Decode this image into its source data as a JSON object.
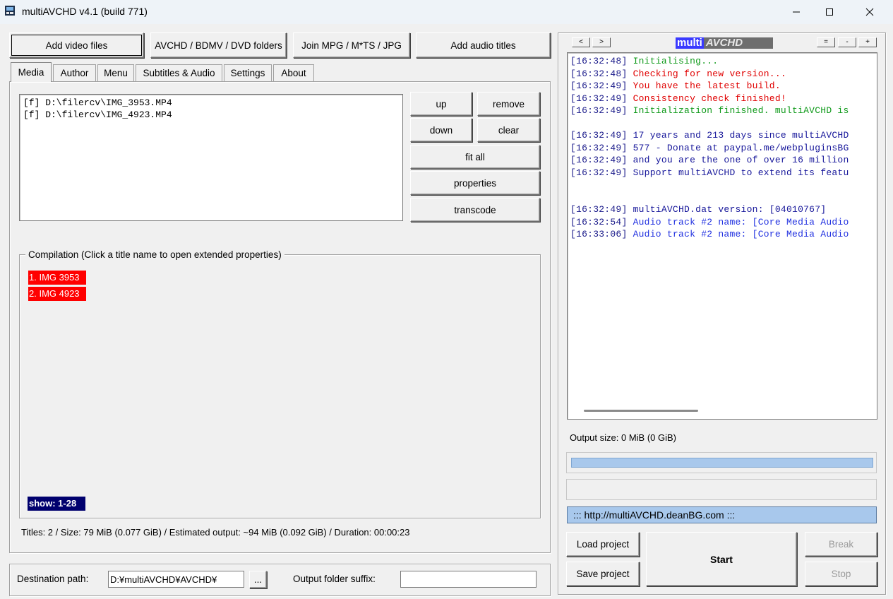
{
  "window": {
    "title": "multiAVCHD v4.1 (build 771)"
  },
  "toolbar": {
    "add_video": "Add video files",
    "avchd_folders": "AVCHD / BDMV / DVD folders",
    "join": "Join MPG / M*TS / JPG",
    "add_audio": "Add audio titles"
  },
  "tabs": [
    "Media",
    "Author",
    "Menu",
    "Subtitles & Audio",
    "Settings",
    "About"
  ],
  "media": {
    "files": [
      "[f] D:\\filercv\\IMG_3953.MP4",
      "[f] D:\\filercv\\IMG_4923.MP4"
    ],
    "buttons": {
      "up": "up",
      "remove": "remove",
      "down": "down",
      "clear": "clear",
      "fit_all": "fit all",
      "properties": "properties",
      "transcode": "transcode"
    }
  },
  "compilation": {
    "legend": "Compilation (Click a title name to open extended properties)",
    "titles": [
      "1. IMG 3953",
      "2. IMG 4923"
    ],
    "show": "show: 1-28"
  },
  "status": "Titles: 2 / Size: 79 MiB (0.077 GiB) / Estimated output: ~94 MiB (0.092 GiB) / Duration: 00:00:23",
  "destination": {
    "label": "Destination path:",
    "value": "D:¥multiAVCHD¥AVCHD¥",
    "browse": "...",
    "suffix_label": "Output folder suffix:",
    "suffix_value": ""
  },
  "log_panel": {
    "nav_prev": "<",
    "nav_next": ">",
    "logo_multi": "multi",
    "logo_avchd": "AVCHD",
    "zoom_buttons": [
      "=",
      "-",
      "+"
    ],
    "lines": [
      {
        "time": "[16:32:48]",
        "text": "Initialising...",
        "color": "green"
      },
      {
        "time": "[16:32:48]",
        "text": "Checking for new version...",
        "color": "red"
      },
      {
        "time": "[16:32:49]",
        "text": "You have the latest build.",
        "color": "red"
      },
      {
        "time": "[16:32:49]",
        "text": "Consistency check finished!",
        "color": "red"
      },
      {
        "time": "[16:32:49]",
        "text": "Initialization finished. multiAVCHD is",
        "color": "green"
      },
      {
        "time": "",
        "text": "",
        "color": "navy"
      },
      {
        "time": "[16:32:49]",
        "text": "17 years and 213 days since multiAVCHD",
        "color": "navy"
      },
      {
        "time": "[16:32:49]",
        "text": "577 - Donate at paypal.me/webpluginsBG",
        "color": "navy"
      },
      {
        "time": "[16:32:49]",
        "text": "and you are the one of over 16 million",
        "color": "navy"
      },
      {
        "time": "[16:32:49]",
        "text": "Support multiAVCHD to extend its featu",
        "color": "navy"
      },
      {
        "time": "",
        "text": "",
        "color": "navy"
      },
      {
        "time": "",
        "text": "",
        "color": "navy"
      },
      {
        "time": "[16:32:49]",
        "text": "multiAVCHD.dat version: [04010767]",
        "color": "navy"
      },
      {
        "time": "[16:32:54]",
        "text": "Audio track #2 name: [Core Media Audio",
        "color": "blue"
      },
      {
        "time": "[16:33:06]",
        "text": "Audio track #2 name: [Core Media Audio",
        "color": "blue"
      }
    ],
    "output_size": "Output size: 0 MiB (0 GiB)",
    "url": "::: http://multiAVCHD.deanBG.com :::",
    "progress": 1.0
  },
  "actions": {
    "load": "Load project",
    "save": "Save project",
    "start": "Start",
    "break": "Break",
    "stop": "Stop"
  },
  "colors": {
    "log_green": "#0f9a1a",
    "log_red": "#e00000",
    "log_blue": "#2030e0",
    "log_navy": "#16169a",
    "title_chip": "#ff0000",
    "progress": "#a8c8ec"
  }
}
